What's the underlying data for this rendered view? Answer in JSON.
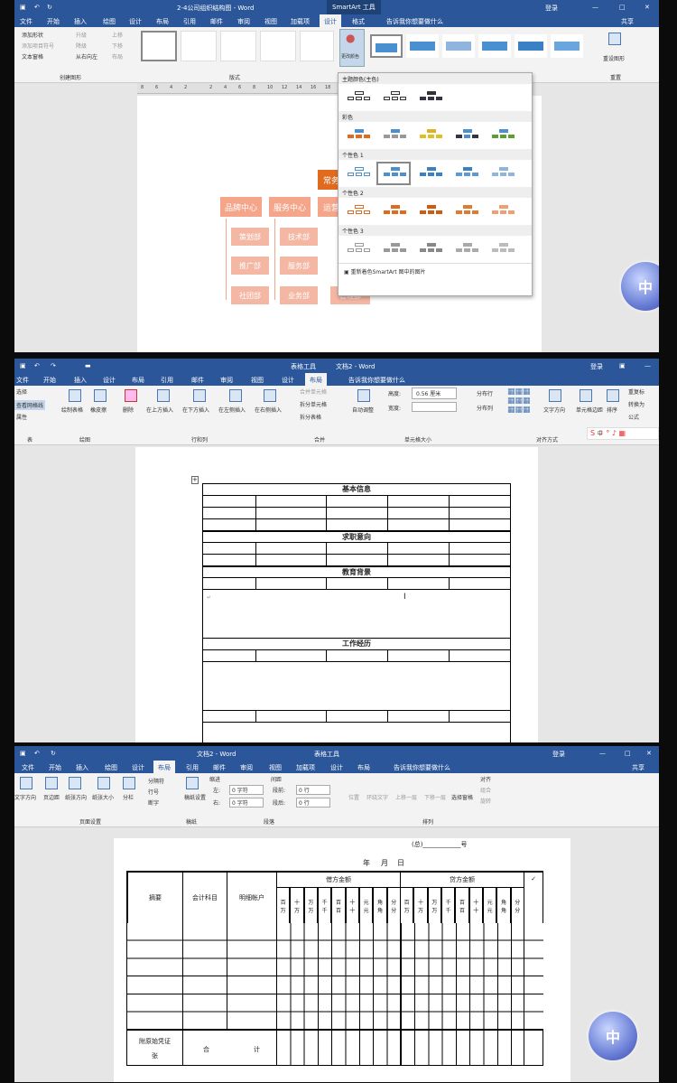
{
  "s1": {
    "title": "2-4公司组织结构图 - Word",
    "ctx": "SmartArt 工具",
    "login": "登录",
    "tabs": [
      "文件",
      "开始",
      "插入",
      "绘图",
      "设计",
      "布局",
      "引用",
      "邮件",
      "审阅",
      "视图",
      "加载项",
      "设计",
      "格式"
    ],
    "tell": "告诉我你想要做什么",
    "share": "共享",
    "create": [
      "添加形状",
      "添加项目符号",
      "文本窗格",
      "升级",
      "降级",
      "从右向左",
      "上移",
      "下移",
      "布局"
    ],
    "group_create": "创建图形",
    "group_layout": "版式",
    "change_color": "更改颜色",
    "reset": "重设图形",
    "group_reset": "重置",
    "dd_sections": [
      "主题颜色(主色)",
      "彩色",
      "个性色 1",
      "个性色 2",
      "个性色 3"
    ],
    "dd_footer": "重新着色SmartArt 图中的图片",
    "org_top": "常务",
    "org_mid": [
      "品牌中心",
      "服务中心",
      "运营"
    ],
    "org_l1": [
      "策划部",
      "推广部",
      "社团部"
    ],
    "org_l2": [
      "技术部",
      "服务部",
      "业务部"
    ],
    "org_l3": [
      "管理部"
    ],
    "ruler": [
      "8",
      "6",
      "4",
      "2",
      "",
      "2",
      "4",
      "6",
      "8",
      "10",
      "12",
      "14",
      "16",
      "18"
    ],
    "logo": "中"
  },
  "s2": {
    "title": "文档2 - Word",
    "ctx": "表格工具",
    "login": "登录",
    "tabs": [
      "文件",
      "开始",
      "插入",
      "设计",
      "布局",
      "引用",
      "邮件",
      "审阅",
      "视图",
      "设计",
      "布局"
    ],
    "tell": "告诉我你想要做什么",
    "left": [
      "选择",
      "查看网格线",
      "属性"
    ],
    "grp_table": "表",
    "draw": [
      "绘制表格",
      "橡皮擦"
    ],
    "grp_draw": "绘图",
    "rowcol": [
      "删除",
      "在上方插入",
      "在下方插入",
      "在左侧插入",
      "在右侧插入"
    ],
    "grp_rowcol": "行和列",
    "merge": [
      "合并单元格",
      "拆分单元格",
      "拆分表格"
    ],
    "grp_merge": "合并",
    "auto": "自动调整",
    "height_label": "高度:",
    "height": "0.56 厘米",
    "width_label": "宽度:",
    "dist": [
      "分布行",
      "分布列"
    ],
    "grp_size": "单元格大小",
    "align": [
      "文字方向",
      "单元格边距"
    ],
    "grp_align": "对齐方式",
    "sort": "排序",
    "data": [
      "重复标",
      "转换为",
      "公式"
    ],
    "headers": [
      "基本信息",
      "求职意向",
      "教育背景",
      "工作经历"
    ],
    "mark": "↵",
    "ime": "中"
  },
  "s3": {
    "title": "文档2 - Word",
    "ctx": "表格工具",
    "login": "登录",
    "share": "共享",
    "tabs": [
      "文件",
      "开始",
      "插入",
      "绘图",
      "设计",
      "布局",
      "引用",
      "邮件",
      "审阅",
      "视图",
      "加载项",
      "设计",
      "布局"
    ],
    "tell": "告诉我你想要做什么",
    "setup": [
      "文字方向",
      "页边距",
      "纸张方向",
      "纸张大小",
      "分栏"
    ],
    "setup2": [
      "分隔符",
      "行号",
      "断字"
    ],
    "grp_setup": "页面设置",
    "manu": "稿纸设置",
    "grp_manu": "稿纸",
    "indent": "缩进",
    "left_l": "左:",
    "left_v": "0 字符",
    "right_l": "右:",
    "right_v": "0 字符",
    "spacing": "间距",
    "before_l": "段前:",
    "before_v": "0 行",
    "after_l": "段后:",
    "after_v": "0 行",
    "grp_para": "段落",
    "arrange": [
      "位置",
      "环绕文字",
      "上移一层",
      "下移一层",
      "选择窗格"
    ],
    "arrange2": [
      "对齐",
      "组合",
      "旋转"
    ],
    "grp_arrange": "排列",
    "header_line": "(总)____________号",
    "date": [
      "年",
      "月",
      "日"
    ],
    "col_summary": "摘要",
    "col_acct": "会计科目",
    "col_detail": "明细帐户",
    "debit": "借方金额",
    "credit": "贷方金额",
    "check": "✓",
    "units1": [
      "百",
      "十",
      "万",
      "千",
      "百",
      "十",
      "元",
      "角",
      "分"
    ],
    "units2": [
      "万",
      "万",
      "万",
      "千",
      "百",
      "十",
      "元",
      "角",
      "分"
    ],
    "foot": [
      "附原始凭证",
      "张",
      "合",
      "计"
    ],
    "logo": "中"
  }
}
